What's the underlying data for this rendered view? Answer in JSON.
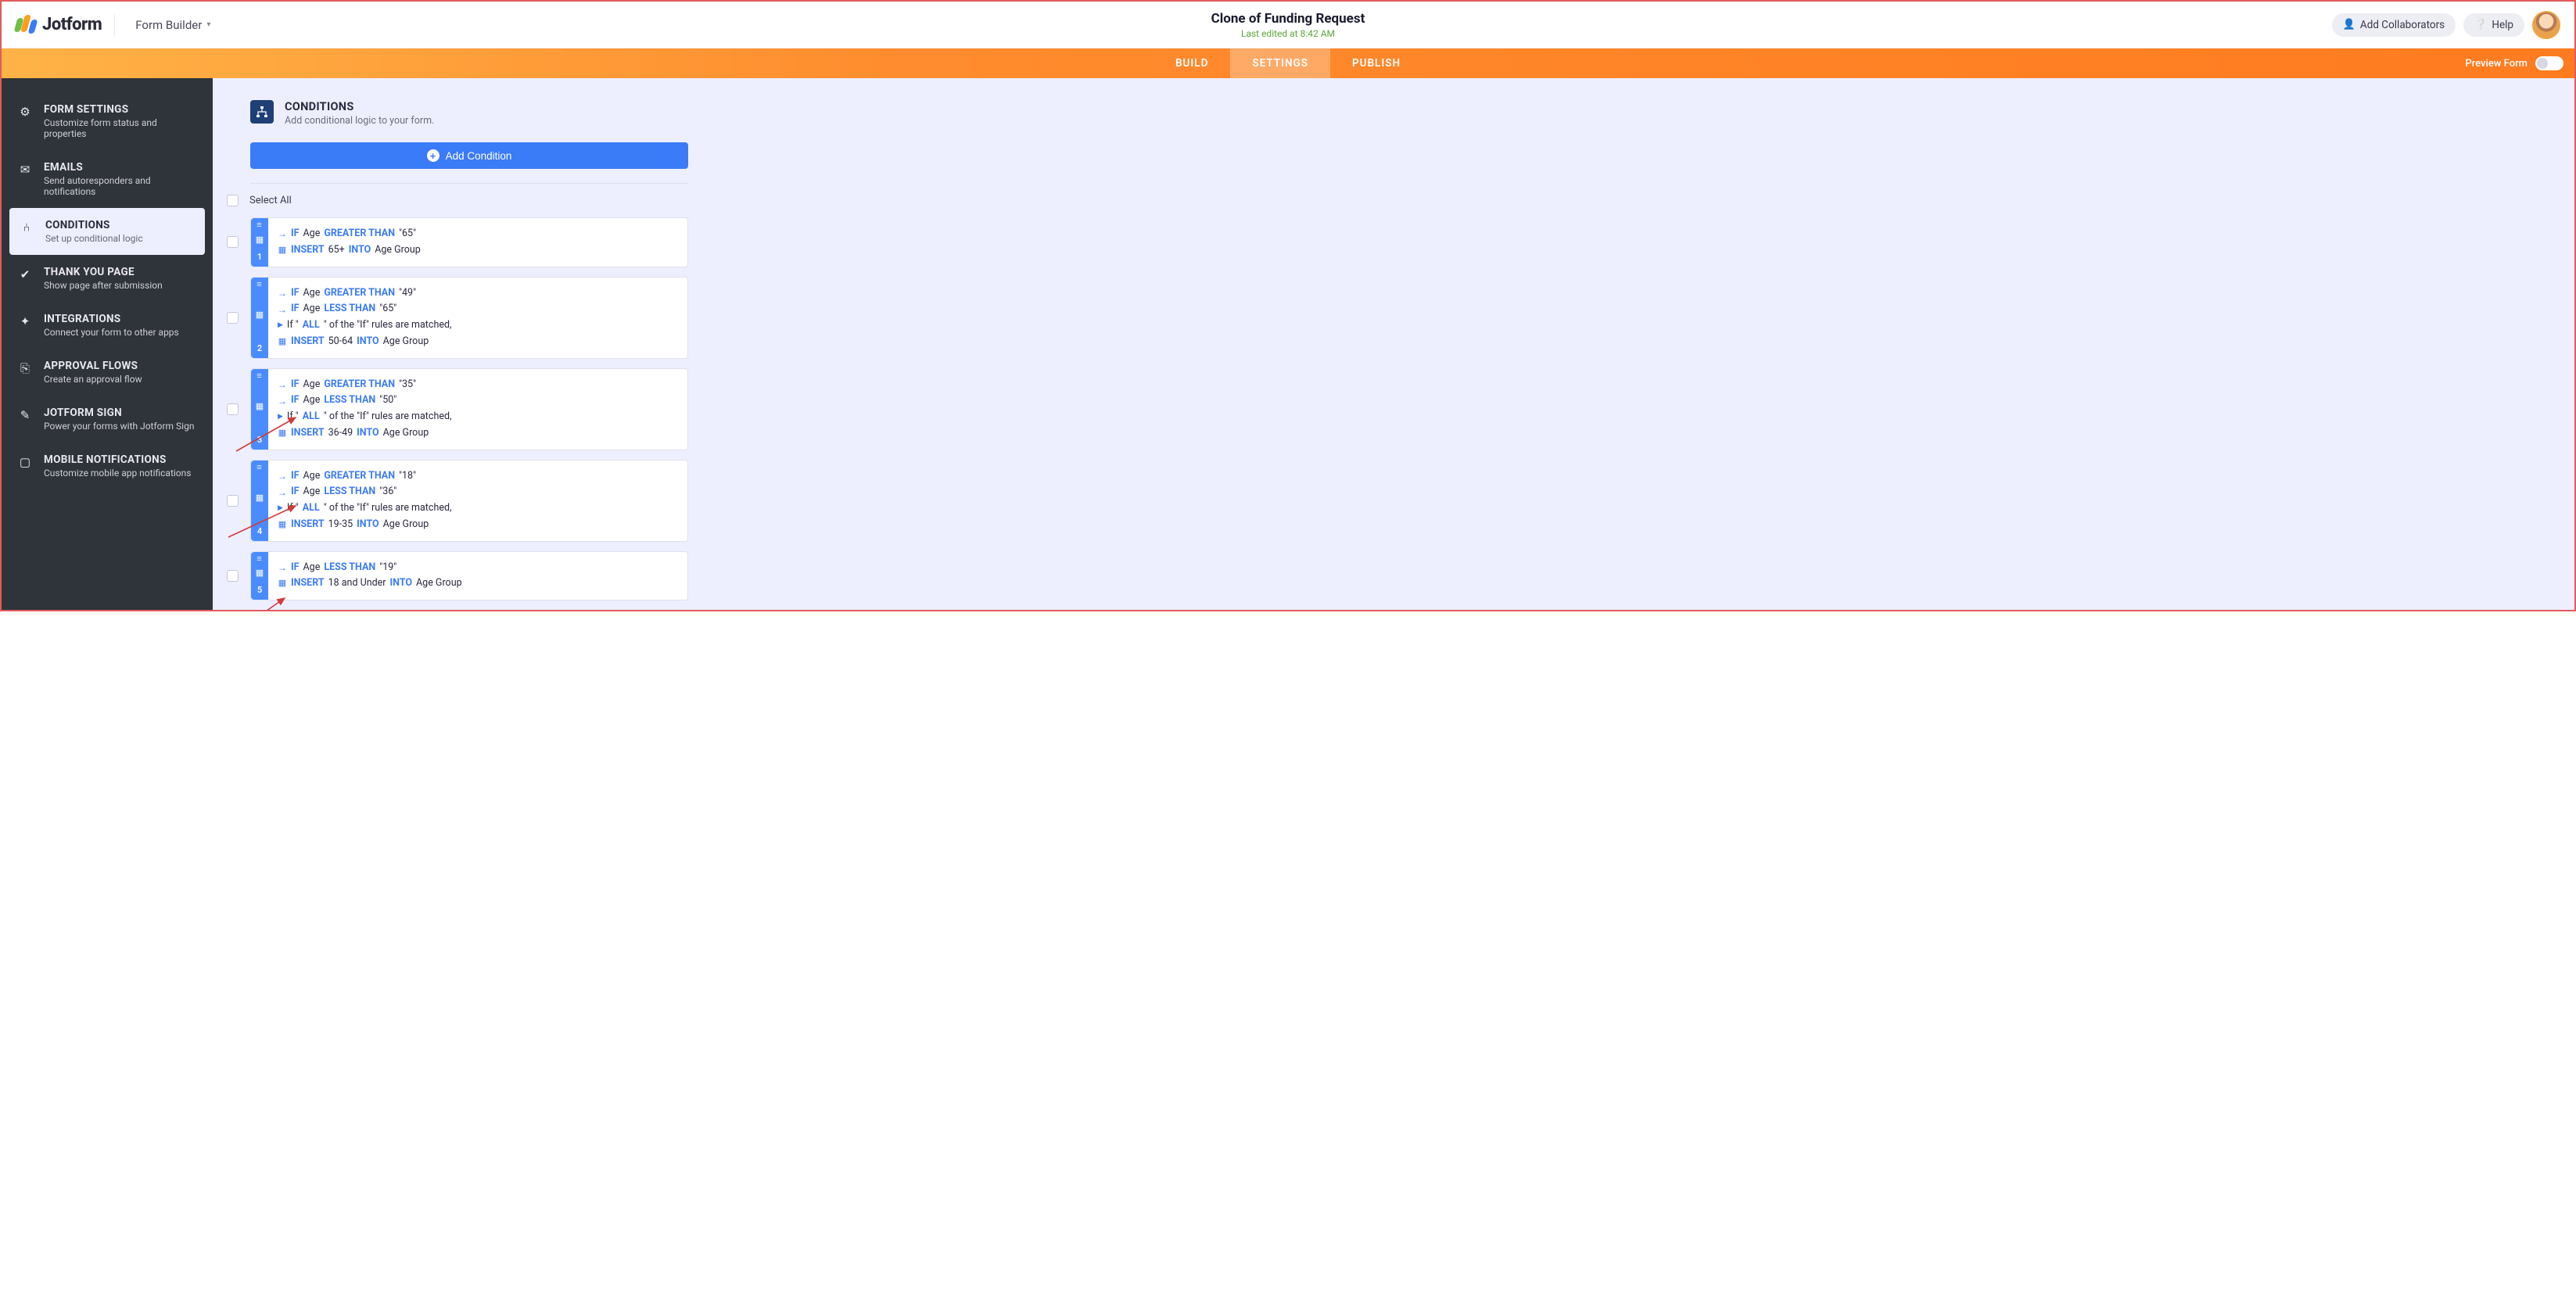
{
  "header": {
    "brand": "Jotform",
    "form_builder_label": "Form Builder",
    "title": "Clone of Funding Request",
    "subtitle": "Last edited at 8:42 AM",
    "collaborators_label": "Add Collaborators",
    "help_label": "Help"
  },
  "tabs": {
    "build": "BUILD",
    "settings": "SETTINGS",
    "publish": "PUBLISH",
    "preview_label": "Preview Form"
  },
  "sidebar": [
    {
      "title": "FORM SETTINGS",
      "desc": "Customize form status and properties",
      "icon": "gear"
    },
    {
      "title": "EMAILS",
      "desc": "Send autoresponders and notifications",
      "icon": "mail"
    },
    {
      "title": "CONDITIONS",
      "desc": "Set up conditional logic",
      "icon": "flow",
      "active": true
    },
    {
      "title": "THANK YOU PAGE",
      "desc": "Show page after submission",
      "icon": "check"
    },
    {
      "title": "INTEGRATIONS",
      "desc": "Connect your form to other apps",
      "icon": "puzzle"
    },
    {
      "title": "APPROVAL FLOWS",
      "desc": "Create an approval flow",
      "icon": "approve"
    },
    {
      "title": "JOTFORM SIGN",
      "desc": "Power your forms with Jotform Sign",
      "icon": "sign"
    },
    {
      "title": "MOBILE NOTIFICATIONS",
      "desc": "Customize mobile app notifications",
      "icon": "mobile"
    }
  ],
  "page": {
    "heading": "CONDITIONS",
    "sub": "Add conditional logic to your form.",
    "add_btn": "Add Condition",
    "select_all": "Select All"
  },
  "kw": {
    "if": "IF",
    "insert": "INSERT",
    "into": "INTO",
    "all": "ALL",
    "match_prefix": "If \"",
    "match_suffix": "\" of the \"If\" rules are matched,"
  },
  "conditions": [
    {
      "num": "1",
      "rules": [
        {
          "field": "Age",
          "op": "GREATER THAN",
          "val": "\"65\""
        }
      ],
      "insert_val": "65+",
      "into_field": "Age Group"
    },
    {
      "num": "2",
      "rules": [
        {
          "field": "Age",
          "op": "GREATER THAN",
          "val": "\"49\""
        },
        {
          "field": "Age",
          "op": "LESS THAN",
          "val": "\"65\""
        }
      ],
      "match_all": true,
      "insert_val": "50-64",
      "into_field": "Age Group"
    },
    {
      "num": "3",
      "rules": [
        {
          "field": "Age",
          "op": "GREATER THAN",
          "val": "\"35\""
        },
        {
          "field": "Age",
          "op": "LESS THAN",
          "val": "\"50\""
        }
      ],
      "match_all": true,
      "insert_val": "36-49",
      "into_field": "Age Group"
    },
    {
      "num": "4",
      "rules": [
        {
          "field": "Age",
          "op": "GREATER THAN",
          "val": "\"18\""
        },
        {
          "field": "Age",
          "op": "LESS THAN",
          "val": "\"36\""
        }
      ],
      "match_all": true,
      "insert_val": "19-35",
      "into_field": "Age Group"
    },
    {
      "num": "5",
      "rules": [
        {
          "field": "Age",
          "op": "LESS THAN",
          "val": "\"19\""
        }
      ],
      "insert_val": "18 and Under",
      "into_field": "Age Group"
    }
  ]
}
